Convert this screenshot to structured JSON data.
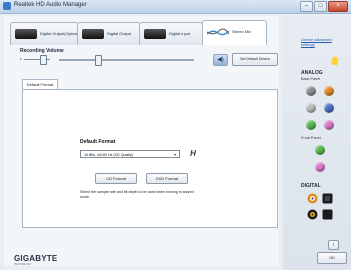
{
  "window": {
    "title": "Realtek HD Audio Manager"
  },
  "device_tabs": [
    {
      "label": "Digital Output(Optical)",
      "active": false
    },
    {
      "label": "Digital Output",
      "active": false
    },
    {
      "label": "Digital Input",
      "active": false
    },
    {
      "label": "Stereo Mix",
      "active": true
    }
  ],
  "recording": {
    "title": "Recording Volume",
    "left_label": "L",
    "right_label": "R",
    "set_default_device_label": "Set Default Device"
  },
  "subtab": {
    "label": "Default Format"
  },
  "default_format": {
    "title": "Default Format",
    "selected": "16 Bits, 44100 Hz (CD Quality)",
    "cd_button": "CD Format",
    "dvd_button": "DVD Format",
    "description": "Select the sample rate and bit depth to be used when running in shared mode."
  },
  "brand": {
    "name": "GIGABYTE",
    "tagline": "TECHNOLOGY"
  },
  "side_panel": {
    "device_advanced": "Device advanced settings",
    "analog_header": "ANALOG",
    "back_panel": "Back Panel",
    "front_panel": "Front Panel",
    "digital_header": "DIGITAL"
  },
  "buttons": {
    "info": "i",
    "ok": "OK"
  },
  "colors": {
    "jack_green": "#56b849",
    "jack_pink": "#d978c6",
    "jack_blue": "#4a6ec4",
    "jack_gray": "#8c8c8c",
    "jack_orange": "#e08a1e",
    "link_blue": "#2a5fb0"
  }
}
